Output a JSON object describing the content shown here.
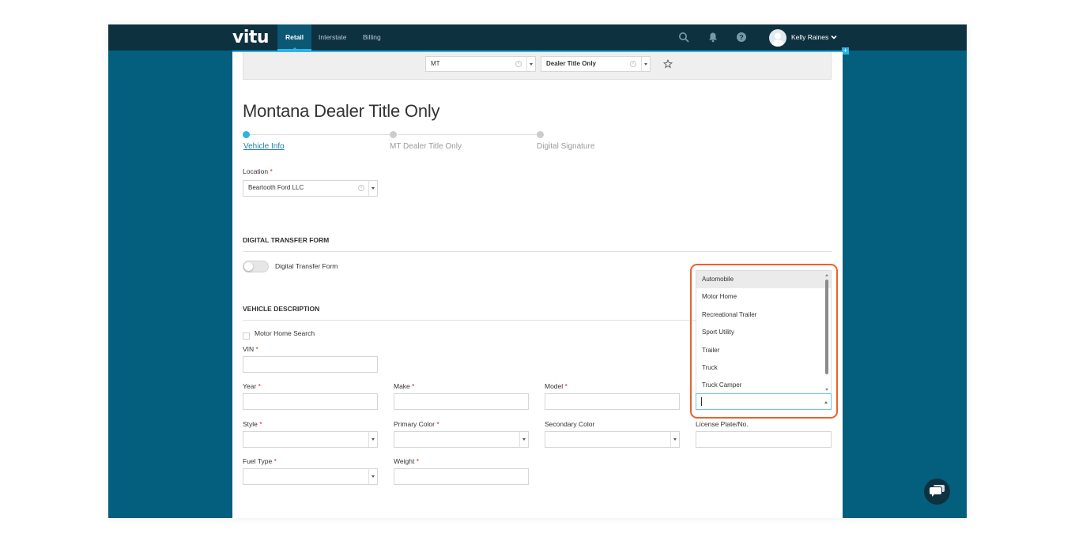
{
  "topbar": {
    "logo": "vitu",
    "tabs": [
      {
        "label": "Retail",
        "active": true
      },
      {
        "label": "Interstate",
        "active": false
      },
      {
        "label": "Billing",
        "active": false
      }
    ],
    "user_name": "Kelly Raines",
    "icons": [
      "search-icon",
      "bell-icon",
      "help-icon"
    ]
  },
  "filters": {
    "state_value": "MT",
    "form_value": "Dealer Title Only"
  },
  "page": {
    "title": "Montana Dealer Title Only",
    "steps": [
      {
        "label": "Vehicle Info",
        "active": true
      },
      {
        "label": "MT Dealer Title Only",
        "active": false
      },
      {
        "label": "Digital Signature",
        "active": false
      }
    ]
  },
  "location": {
    "label": "Location",
    "required_mark": "*",
    "value": "Beartooth Ford LLC"
  },
  "digital_transfer": {
    "section_title": "DIGITAL TRANSFER FORM",
    "toggle_label": "Digital Transfer Form"
  },
  "vehicle": {
    "section_title": "VEHICLE DESCRIPTION",
    "motor_home_search_label": "Motor Home Search",
    "vin_label": "VIN",
    "year_label": "Year",
    "make_label": "Make",
    "model_label": "Model",
    "style_label": "Style",
    "primary_color_label": "Primary Color",
    "secondary_color_label": "Secondary Color",
    "license_plate_label": "License Plate/No.",
    "fuel_type_label": "Fuel Type",
    "weight_label": "Weight",
    "required_mark": "*"
  },
  "body_type_dropdown": {
    "options": [
      "Automobile",
      "Motor Home",
      "Recreational Trailer",
      "Sport Utility",
      "Trailer",
      "Truck",
      "Truck Camper"
    ],
    "highlighted": "Automobile"
  },
  "colors": {
    "topbar": "#0e3140",
    "background": "#035f7d",
    "accent": "#2ab3e6",
    "highlight_border": "#e8622e",
    "required": "#d9251d"
  }
}
